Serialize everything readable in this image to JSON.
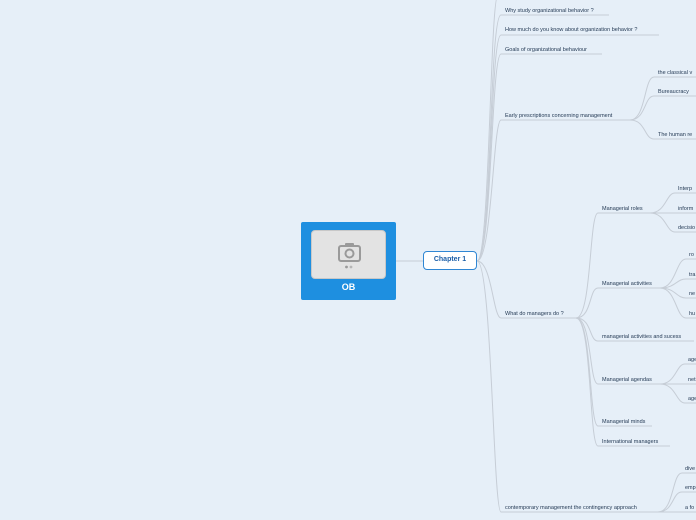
{
  "root": {
    "title": "OB",
    "image_icon": "camera-icon"
  },
  "center": {
    "title": "Chapter 1"
  },
  "topics": {
    "why": "Why study organizational behavior ?",
    "how_much": "How much do you know about organization behavior ?",
    "goals": "Goals of organizational behaviour",
    "early": "Early prescriptions concerning management",
    "what_do": "What do managers do ?",
    "contemporary": "contemporary management the contingency approach"
  },
  "early_children": {
    "classical": "the classical v",
    "bureaucracy": "Bureaucracy",
    "human": "The human re"
  },
  "managers_children": {
    "roles": "Managerial roles",
    "activities": "Managerial activities",
    "success": "managerial activities and sucess",
    "agendas": "Managerial agendas",
    "minds": "Managerial minds",
    "international": "International managers"
  },
  "roles_children": {
    "a": "Interp",
    "b": "inform",
    "c": "decisio"
  },
  "activities_children": {
    "a": "ro",
    "b": "tra",
    "c": "ne",
    "d": "hu"
  },
  "agendas_children": {
    "a": "age",
    "b": "net",
    "c": "age"
  },
  "contemporary_children": {
    "a": "dive",
    "b": "emp",
    "c": "a fo"
  },
  "colors": {
    "background": "#e6eff8",
    "root": "#1e8fe0",
    "center_border": "#2f86d3",
    "line": "#c6cdd6"
  }
}
